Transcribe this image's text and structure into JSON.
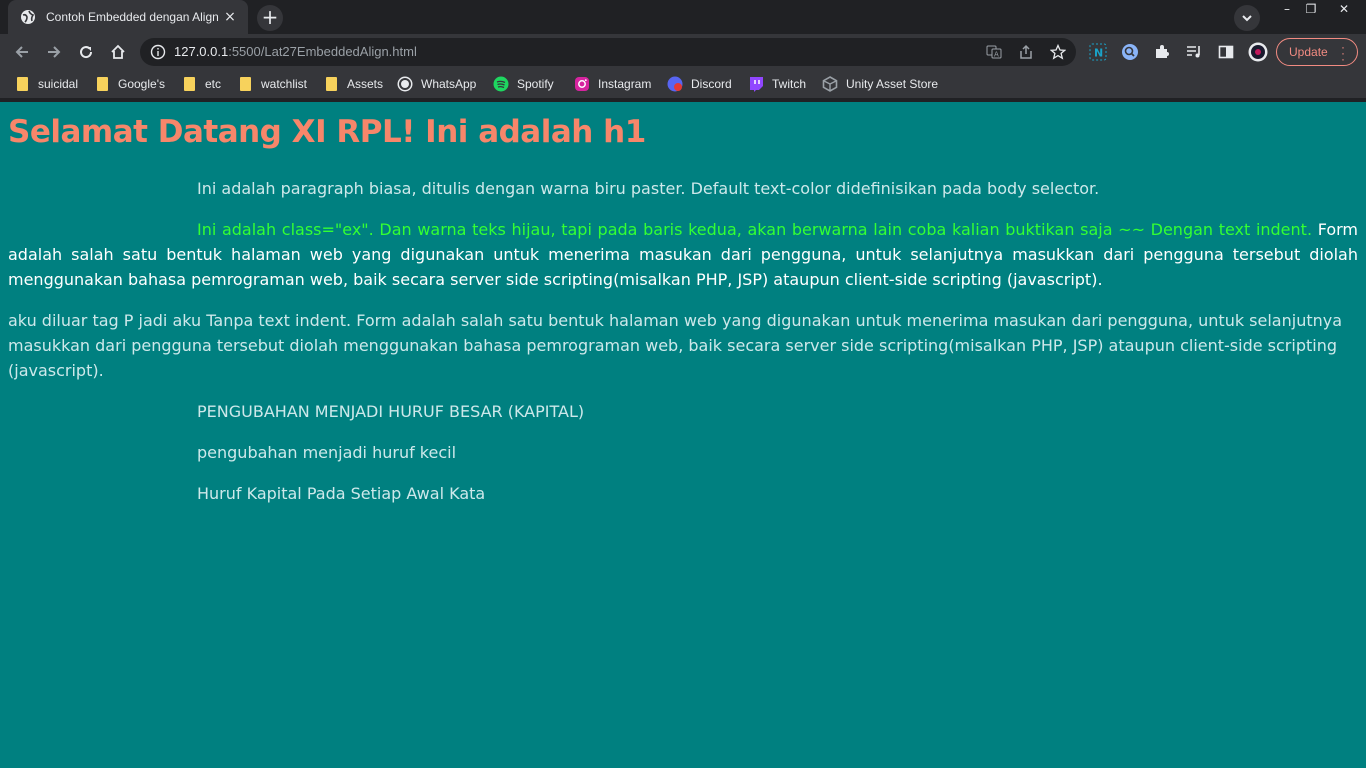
{
  "browser": {
    "tab_title": "Contoh Embedded dengan Align",
    "tab_close": "×",
    "new_tab": "+",
    "url_host": "127.0.0.1",
    "url_rest": ":5500/Lat27EmbeddedAlign.html",
    "update_label": "Update",
    "window_controls": {
      "minimize": "–",
      "maximize": "❐",
      "close": "✕"
    }
  },
  "bookmarks": [
    {
      "label": "suicidal",
      "icon": "folder-icon"
    },
    {
      "label": "Google's",
      "icon": "folder-icon"
    },
    {
      "label": "etc",
      "icon": "folder-icon"
    },
    {
      "label": "watchlist",
      "icon": "folder-icon"
    },
    {
      "label": "Assets",
      "icon": "folder-icon"
    },
    {
      "label": "WhatsApp",
      "icon": "whatsapp-icon"
    },
    {
      "label": "Spotify",
      "icon": "spotify-icon"
    },
    {
      "label": "Instagram",
      "icon": "instagram-icon"
    },
    {
      "label": "Discord",
      "icon": "discord-icon"
    },
    {
      "label": "Twitch",
      "icon": "twitch-icon"
    },
    {
      "label": "Unity Asset Store",
      "icon": "unity-icon"
    }
  ],
  "content": {
    "h1": "Selamat Datang XI RPL! Ini adalah h1",
    "p1": "Ini adalah paragraph biasa, ditulis dengan warna biru paster. Default text-color didefinisikan pada body selector.",
    "p2_green": "Ini adalah class=\"ex\". Dan warna teks hijau, tapi pada baris kedua, akan berwarna lain coba kalian buktikan saja ~~ Dengan text indent.",
    "p2_rest": " Form adalah salah satu bentuk halaman web yang digunakan untuk menerima masukan dari pengguna, untuk selanjutnya masukkan dari pengguna tersebut diolah menggunakan bahasa pemrograman web, baik secara server side scripting(misalkan PHP, JSP) ataupun client-side scripting (javascript).",
    "p3": "aku diluar tag P jadi aku Tanpa text indent. Form adalah salah satu bentuk halaman web yang digunakan untuk menerima masukan dari pengguna, untuk selanjutnya masukkan dari pengguna tersebut diolah menggunakan bahasa pemrograman web, baik secara server side scripting(misalkan PHP, JSP) ataupun client-side scripting (javascript).",
    "p4": "PENGUBAHAN MENJADI HURUF BESAR (KAPITAL)",
    "p5": "pengubahan menjadi huruf kecil",
    "p6": "Huruf Kapital Pada Setiap Awal Kata"
  },
  "colors": {
    "page_bg": "#008080",
    "h1": "#f7866a",
    "body_text": "#cde8ea",
    "ex_green": "#33ff33",
    "ex_white": "#ffffff"
  }
}
